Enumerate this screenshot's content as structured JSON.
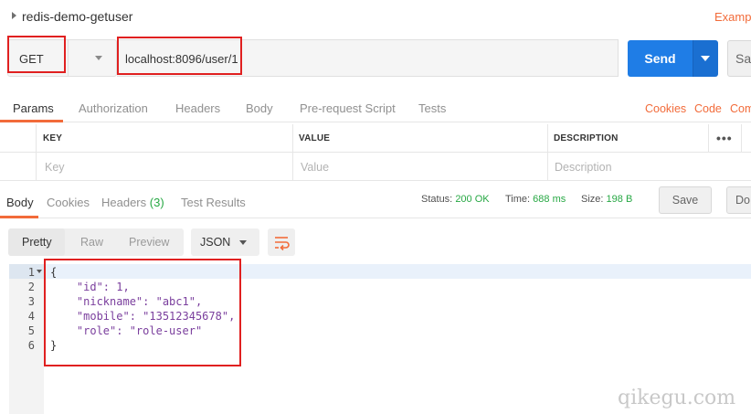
{
  "request": {
    "name": "redis-demo-getuser",
    "examples_label": "Exampl",
    "method": "GET",
    "url": "localhost:8096/user/1",
    "send_label": "Send",
    "save_label": "Sa"
  },
  "request_tabs": [
    "Params",
    "Authorization",
    "Headers",
    "Body",
    "Pre-request Script",
    "Tests"
  ],
  "request_links": [
    "Cookies",
    "Code",
    "Com"
  ],
  "params_table": {
    "headers": [
      "KEY",
      "VALUE",
      "DESCRIPTION"
    ],
    "more_label": "•••",
    "placeholders": [
      "Key",
      "Value",
      "Description"
    ]
  },
  "response_tabs": {
    "body": "Body",
    "cookies": "Cookies",
    "headers": "Headers",
    "headers_count": "(3)",
    "test_results": "Test Results"
  },
  "response_status": {
    "status_label": "Status:",
    "status_value": "200 OK",
    "time_label": "Time:",
    "time_value": "688 ms",
    "size_label": "Size:",
    "size_value": "198 B"
  },
  "response_actions": {
    "save": "Save",
    "download": "Do"
  },
  "format_toolbar": {
    "modes": [
      "Pretty",
      "Raw",
      "Preview"
    ],
    "language": "JSON",
    "wrap_icon": "wrap-lines-icon"
  },
  "response_body": {
    "line_numbers": [
      "1",
      "2",
      "3",
      "4",
      "5",
      "6"
    ],
    "lines": [
      "{",
      "    \"id\": 1,",
      "    \"nickname\": \"abc1\",",
      "    \"mobile\": \"13512345678\",",
      "    \"role\": \"role-user\"",
      "}"
    ]
  },
  "colors": {
    "accent": "#f26b3a",
    "send_blue": "#1f7de6",
    "status_green": "#27a844",
    "highlight_red": "#e02020"
  },
  "watermark": "qikegu.com"
}
